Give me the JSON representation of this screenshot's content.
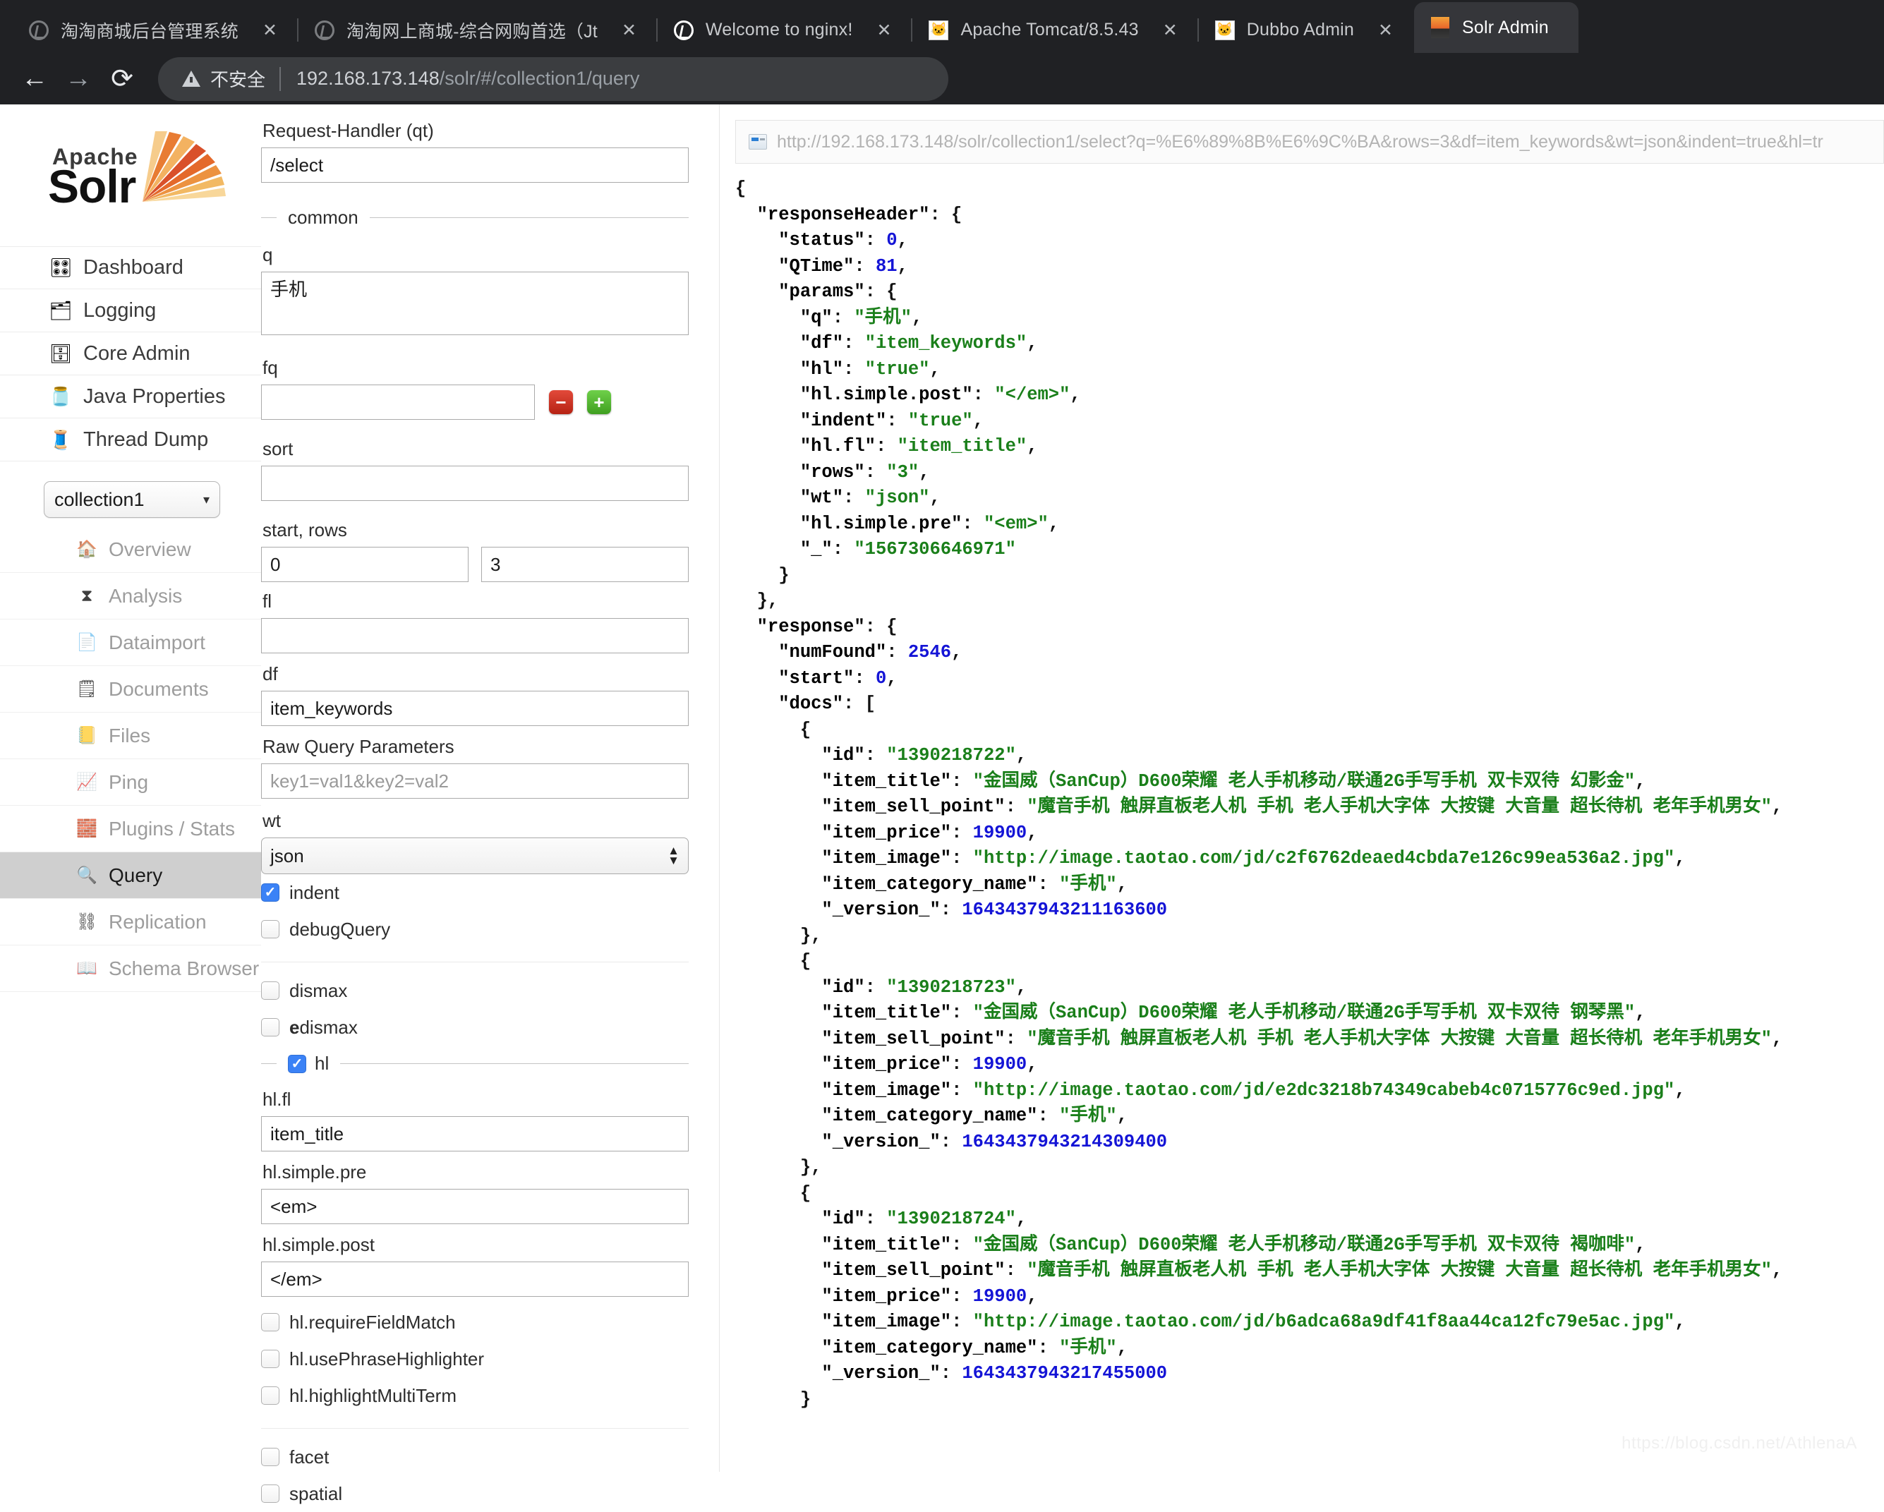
{
  "browser": {
    "tabs": [
      {
        "title": "淘淘商城后台管理系统",
        "icon": "globe-icon",
        "active": false,
        "close": "✕"
      },
      {
        "title": "淘淘网上商城-综合网购首选（Jt",
        "icon": "globe-icon",
        "active": false,
        "close": "✕"
      },
      {
        "title": "Welcome to nginx!",
        "icon": "globe-icon",
        "active": false,
        "close": "✕"
      },
      {
        "title": "Apache Tomcat/8.5.43",
        "icon": "tomcat-icon",
        "active": false,
        "close": "✕"
      },
      {
        "title": "Dubbo Admin",
        "icon": "tomcat-icon",
        "active": false,
        "close": "✕"
      },
      {
        "title": "Solr Admin",
        "icon": "solr-icon",
        "active": true,
        "close": ""
      }
    ],
    "nav": {
      "back": "←",
      "forward": "→",
      "reload": "⟳"
    },
    "security_label": "不安全",
    "url_host": "192.168.173.148",
    "url_path": "/solr/#/collection1/query"
  },
  "sidebar": {
    "logo": {
      "top": "Apache",
      "bottom": "Solr"
    },
    "items": [
      {
        "label": "Dashboard",
        "icon": "dashboard-icon",
        "glyph": "🎛"
      },
      {
        "label": "Logging",
        "icon": "logging-icon",
        "glyph": "🗂"
      },
      {
        "label": "Core Admin",
        "icon": "core-admin-icon",
        "glyph": "🗄"
      },
      {
        "label": "Java Properties",
        "icon": "java-properties-icon",
        "glyph": "🫙"
      },
      {
        "label": "Thread Dump",
        "icon": "thread-dump-icon",
        "glyph": "🧵"
      }
    ],
    "core_select": {
      "value": "collection1",
      "arrow": "▾"
    },
    "sub_items": [
      {
        "label": "Overview",
        "icon": "home-icon",
        "glyph": "🏠",
        "selected": false
      },
      {
        "label": "Analysis",
        "icon": "funnel-icon",
        "glyph": "⧗",
        "selected": false
      },
      {
        "label": "Dataimport",
        "icon": "dataimport-icon",
        "glyph": "📄",
        "selected": false
      },
      {
        "label": "Documents",
        "icon": "documents-icon",
        "glyph": "🗒",
        "selected": false
      },
      {
        "label": "Files",
        "icon": "files-icon",
        "glyph": "📒",
        "selected": false
      },
      {
        "label": "Ping",
        "icon": "ping-icon",
        "glyph": "📈",
        "selected": false
      },
      {
        "label": "Plugins / Stats",
        "icon": "plugins-icon",
        "glyph": "🧱",
        "selected": false
      },
      {
        "label": "Query",
        "icon": "magnifier-icon",
        "glyph": "🔍",
        "selected": true
      },
      {
        "label": "Replication",
        "icon": "replication-icon",
        "glyph": "⛓",
        "selected": false
      },
      {
        "label": "Schema Browser",
        "icon": "schema-browser-icon",
        "glyph": "📖",
        "selected": false
      }
    ]
  },
  "query_form": {
    "request_handler": {
      "label": "Request-Handler (qt)",
      "value": "/select"
    },
    "common_title": "common",
    "q": {
      "label": "q",
      "value": "手机"
    },
    "fq": {
      "label": "fq",
      "value": "",
      "minus": "−",
      "plus": "+"
    },
    "sort": {
      "label": "sort",
      "value": ""
    },
    "start_rows": {
      "label": "start, rows",
      "start": "0",
      "rows": "3"
    },
    "fl": {
      "label": "fl",
      "value": ""
    },
    "df": {
      "label": "df",
      "value": "item_keywords"
    },
    "raw_query_parameters": {
      "label": "Raw Query Parameters",
      "placeholder": "key1=val1&key2=val2",
      "value": ""
    },
    "wt": {
      "label": "wt",
      "value": "json"
    },
    "indent": {
      "label": "indent",
      "checked": true
    },
    "debugQuery": {
      "label": "debugQuery",
      "checked": false
    },
    "dismax": {
      "label": "dismax",
      "checked": false
    },
    "edismax_bold": "e",
    "edismax_rest": "dismax",
    "hl": {
      "label": "hl",
      "checked": true
    },
    "hl_fl": {
      "label": "hl.fl",
      "value": "item_title"
    },
    "hl_simple_pre": {
      "label": "hl.simple.pre",
      "value": "<em>"
    },
    "hl_simple_post": {
      "label": "hl.simple.post",
      "value": "</em>"
    },
    "hl_requireFieldMatch": {
      "label": "hl.requireFieldMatch",
      "checked": false
    },
    "hl_usePhraseHighlighter": {
      "label": "hl.usePhraseHighlighter",
      "checked": false
    },
    "hl_highlightMultiTerm": {
      "label": "hl.highlightMultiTerm",
      "checked": false
    },
    "facet": {
      "label": "facet",
      "checked": false
    },
    "spatial": {
      "label": "spatial",
      "checked": false
    }
  },
  "result": {
    "url": "http://192.168.173.148/solr/collection1/select?q=%E6%89%8B%E6%9C%BA&rows=3&df=item_keywords&wt=json&indent=true&hl=tr",
    "response_header": {
      "status": 0,
      "QTime": 81,
      "params": {
        "q": "手机",
        "df": "item_keywords",
        "hl": "true",
        "hl.simple.post": "</em>",
        "indent": "true",
        "hl.fl": "item_title",
        "rows": "3",
        "wt": "json",
        "hl.simple.pre": "<em>",
        "_": "1567306646971"
      }
    },
    "response": {
      "numFound": 2546,
      "start": 0,
      "docs": [
        {
          "id": "1390218722",
          "item_title": "金国威（SanCup）D600荣耀 老人手机移动/联通2G手写手机 双卡双待 幻影金",
          "item_sell_point": "魔音手机 触屏直板老人机 手机 老人手机大字体 大按键 大音量 超长待机 老年手机男女",
          "item_price": 19900,
          "item_image": "http://image.taotao.com/jd/c2f6762deaed4cbda7e126c99ea536a2.jpg",
          "item_category_name": "手机",
          "_version_": 1643437943211163600
        },
        {
          "id": "1390218723",
          "item_title": "金国威（SanCup）D600荣耀 老人手机移动/联通2G手写手机 双卡双待 钢琴黑",
          "item_sell_point": "魔音手机 触屏直板老人机 手机 老人手机大字体 大按键 大音量 超长待机 老年手机男女",
          "item_price": 19900,
          "item_image": "http://image.taotao.com/jd/e2dc3218b74349cabeb4c0715776c9ed.jpg",
          "item_category_name": "手机",
          "_version_": 1643437943214309400
        },
        {
          "id": "1390218724",
          "item_title": "金国威（SanCup）D600荣耀 老人手机移动/联通2G手写手机 双卡双待 褐咖啡",
          "item_sell_point": "魔音手机 触屏直板老人机 手机 老人手机大字体 大按键 大音量 超长待机 老年手机男女",
          "item_price": 19900,
          "item_image": "http://image.taotao.com/jd/b6adca68a9df41f8aa44ca12fc79e5ac.jpg",
          "item_category_name": "手机",
          "_version_": 1643437943217455000
        }
      ]
    }
  },
  "watermark": "https://blog.csdn.net/AthlenaA"
}
